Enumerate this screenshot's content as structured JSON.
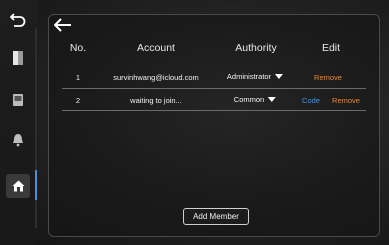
{
  "sidebar": {
    "items": [
      {
        "icon": "undo-arrow-icon"
      },
      {
        "icon": "door-icon"
      },
      {
        "icon": "tablet-icon"
      },
      {
        "icon": "bell-icon"
      },
      {
        "icon": "home-icon",
        "active": true
      }
    ]
  },
  "header": {
    "back_icon": "left-arrow-icon"
  },
  "table": {
    "columns": [
      "No.",
      "Account",
      "Authority",
      "Edit"
    ],
    "rows": [
      {
        "no": "1",
        "account": "survinhwang@icloud.com",
        "authority": "Administrator",
        "edit": {
          "remove": "Remove"
        }
      },
      {
        "no": "2",
        "account": "waiting to join...",
        "authority": "Common",
        "edit": {
          "code": "Code",
          "remove": "Remove"
        }
      }
    ]
  },
  "footer": {
    "add_member_label": "Add Member"
  },
  "colors": {
    "remove": "#e08a3a",
    "code": "#4a90d9",
    "active_rail": "#4a90d9"
  }
}
